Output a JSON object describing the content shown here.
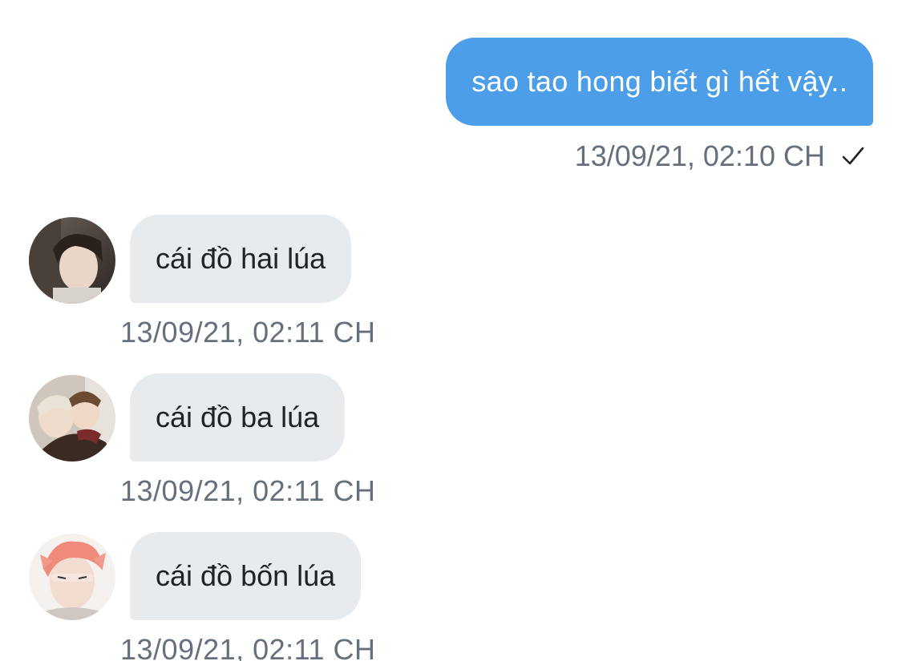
{
  "colors": {
    "outgoing_bubble": "#4c9ee8",
    "incoming_bubble": "#e7ebee",
    "timestamp": "#66707c"
  },
  "outgoing": {
    "text": "sao tao hong biết gì hết vậy..",
    "timestamp": "13/09/21, 02:10 CH",
    "status_icon": "checkmark-icon"
  },
  "incoming": [
    {
      "avatar": "avatar-dark-hair",
      "text": "cái đồ hai lúa",
      "timestamp": "13/09/21, 02:11 CH"
    },
    {
      "avatar": "avatar-two-people",
      "text": "cái đồ ba lúa",
      "timestamp": "13/09/21, 02:11 CH"
    },
    {
      "avatar": "avatar-pink-hair",
      "text": "cái đồ bốn lúa",
      "timestamp": "13/09/21, 02:11 CH"
    }
  ]
}
